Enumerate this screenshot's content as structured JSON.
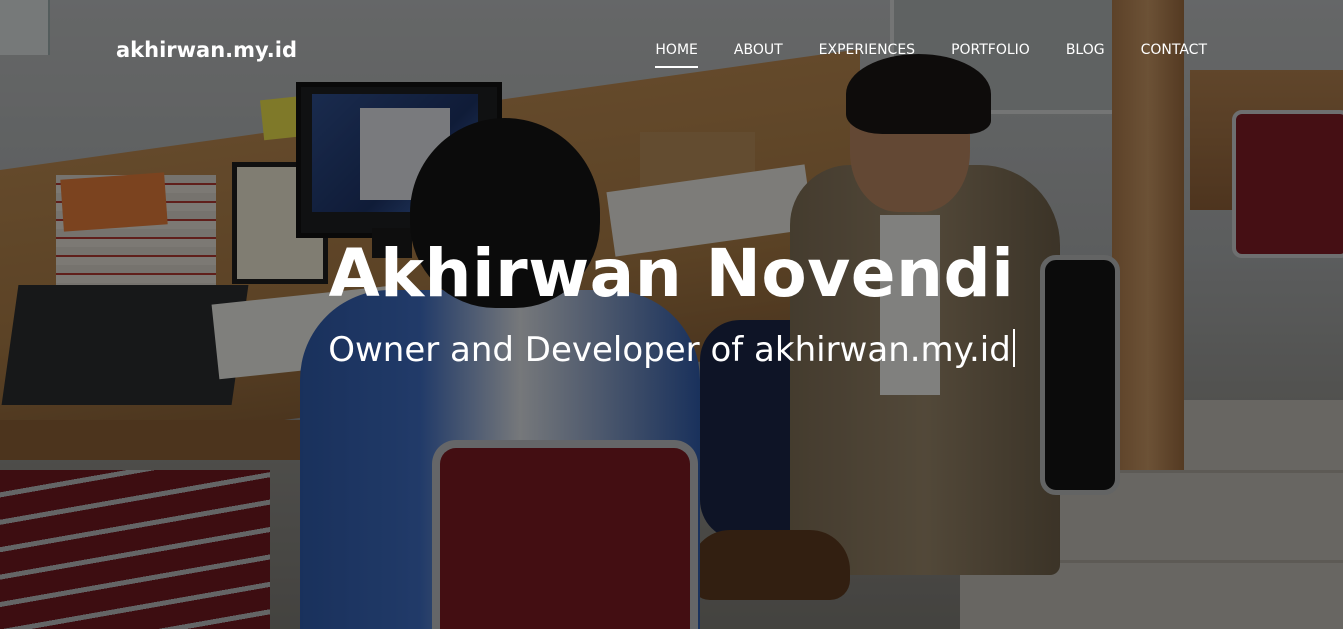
{
  "navbar": {
    "brand": "akhirwan.my.id",
    "items": [
      {
        "label": "HOME",
        "active": true
      },
      {
        "label": "ABOUT",
        "active": false
      },
      {
        "label": "EXPERIENCES",
        "active": false
      },
      {
        "label": "PORTFOLIO",
        "active": false
      },
      {
        "label": "BLOG",
        "active": false
      },
      {
        "label": "CONTACT",
        "active": false
      }
    ]
  },
  "hero": {
    "title": "Akhirwan Novendi",
    "subtitle": "Owner and Developer of akhirwan.my.id",
    "overlay_color": "#000000",
    "text_color": "#ffffff"
  }
}
